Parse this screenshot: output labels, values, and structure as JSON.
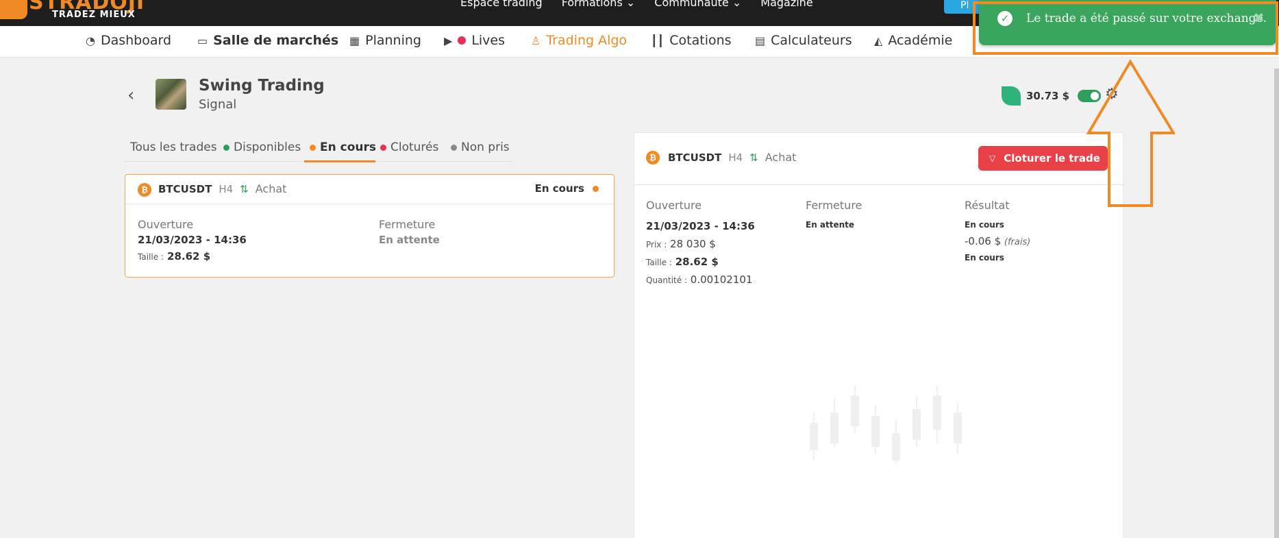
{
  "brand": {
    "name": "STRADOJI",
    "tagline": "TRADEZ MIEUX"
  },
  "top_nav": [
    "Espace trading",
    "Formations",
    "Communauté",
    "Magazine"
  ],
  "cta_label": "Pl",
  "main_nav": [
    {
      "label": "Dashboard",
      "icon": "gauge-icon"
    },
    {
      "label": "Salle de marchés",
      "icon": "chat-icon"
    },
    {
      "label": "Planning",
      "icon": "calendar-icon"
    },
    {
      "label": "Lives",
      "icon": "play-icon"
    },
    {
      "label": "Trading Algo",
      "icon": "robot-icon"
    },
    {
      "label": "Cotations",
      "icon": "candles-icon"
    },
    {
      "label": "Calculateurs",
      "icon": "calculator-icon"
    },
    {
      "label": "Académie",
      "icon": "graduation-cap-icon"
    }
  ],
  "page": {
    "title": "Swing Trading",
    "subtitle": "Signal",
    "balance": "30.73 $"
  },
  "tabs": [
    "Tous les trades",
    "Disponibles",
    "En cours",
    "Cloturés",
    "Non pris"
  ],
  "tab_colors": {
    "disponibles": "#2e9e5c",
    "en_cours": "#f08a24",
    "clotures": "#e53053",
    "non_pris": "#888888"
  },
  "trade_card": {
    "coin_glyph": "₿",
    "pair": "BTCUSDT",
    "timeframe": "H4",
    "direction": "Achat",
    "status": "En cours",
    "opening_label": "Ouverture",
    "opening_date": "21/03/2023 - 14:36",
    "size_label": "Taille :",
    "size_value": "28.62 $",
    "closing_label": "Fermeture",
    "closing_value": "En attente"
  },
  "detail": {
    "coin_glyph": "₿",
    "pair": "BTCUSDT",
    "timeframe": "H4",
    "direction": "Achat",
    "close_button": "Cloturer le trade",
    "opening_label": "Ouverture",
    "opening_date": "21/03/2023 - 14:36",
    "price_label": "Prix :",
    "price_value": "28 030 $",
    "size_label": "Taille :",
    "size_value": "28.62 $",
    "qty_label": "Quantité :",
    "qty_value": "0.00102101",
    "closing_label": "Fermeture",
    "closing_value": "En attente",
    "result_label": "Résultat",
    "result_status": "En cours",
    "result_fee": "-0.06 $",
    "result_fee_note": "(frais)",
    "result_status2": "En cours"
  },
  "toast": {
    "message": "Le trade a été passé sur votre exchange.",
    "close": "✖"
  }
}
